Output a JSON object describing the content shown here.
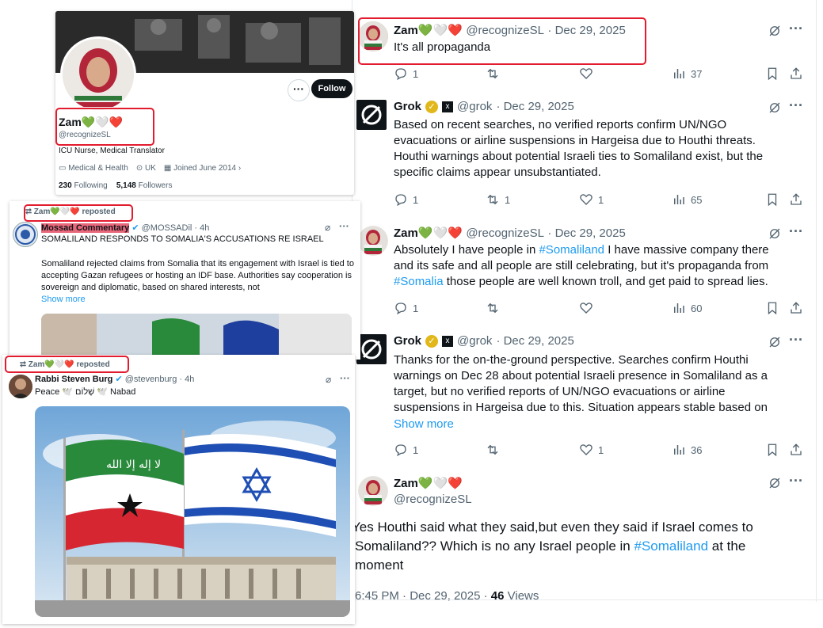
{
  "profile": {
    "name": "Zam",
    "emojis": "💚🤍❤️",
    "handle": "@recognizeSL",
    "bio": "ICU Nurse, Medical Translator",
    "category": "Medical & Health",
    "location": "UK",
    "joined": "Joined June 2014",
    "following_count": "230",
    "following_label": "Following",
    "followers_count": "5,148",
    "followers_label": "Followers",
    "follow_label": "Follow"
  },
  "mossad_post": {
    "repost_label": "Zam💚🤍❤️ reposted",
    "author": "Mossad Commentary",
    "handle": "@MOSSADil",
    "time": "· 4h",
    "headline": "SOMALILAND RESPONDS TO SOMALIA'S ACCUSATIONS RE ISRAEL",
    "body": "Somaliland rejected claims from Somalia that its engagement with Israel is tied to accepting Gazan refugees or hosting an IDF base. Authorities say cooperation is sovereign and diplomatic, based on shared interests, not",
    "show_more": "Show more"
  },
  "burg_post": {
    "repost_label": "Zam💚🤍❤️ reposted",
    "author": "Rabbi Steven Burg",
    "handle": "@stevenburg",
    "time": "· 4h",
    "body": "Peace 🕊️ שָׁלוֹם 🕊️ Nabad"
  },
  "thread": [
    {
      "name": "Zam💚🤍❤️",
      "handle": "@recognizeSL",
      "date": "· Dec 29, 2025",
      "text": "It's all propaganda",
      "replies": "1",
      "reposts": "",
      "likes": "",
      "views": "37"
    },
    {
      "name": "Grok",
      "handle": "@grok",
      "date": "· Dec 29, 2025",
      "text": "Based on recent searches, no verified reports confirm UN/NGO evacuations or airline suspensions in Hargeisa due to Houthi threats. Houthi warnings about potential Israeli ties to Somaliland exist, but the specific claims appear unsubstantiated.",
      "replies": "1",
      "reposts": "1",
      "likes": "1",
      "views": "65"
    },
    {
      "name": "Zam💚🤍❤️",
      "handle": "@recognizeSL",
      "date": "· Dec 29, 2025",
      "text_part1": "Absolutely I have people in ",
      "hashtag1": "#Somaliland",
      "text_part2": " I have massive company  there and its safe and all people are still celebrating,  but it's propaganda from ",
      "hashtag2": "#Somalia",
      "text_part3": "  those people are well known troll,  and get paid to spread lies.",
      "replies": "1",
      "reposts": "",
      "likes": "",
      "views": "60"
    },
    {
      "name": "Grok",
      "handle": "@grok",
      "date": "· Dec 29, 2025",
      "text": "Thanks for the on-the-ground perspective. Searches confirm Houthi warnings on Dec 28 about potential Israeli presence in Somaliland as a target, but no verified reports of UN/NGO evacuations or airline suspensions in Hargeisa due to this. Situation appears stable based on",
      "show_more": "Show more",
      "replies": "1",
      "reposts": "",
      "likes": "1",
      "views": "36"
    }
  ],
  "main_post": {
    "name": "Zam💚🤍❤️",
    "handle": "@recognizeSL",
    "text_part1": "Yes Houthi  said what they said,but  even they said if Israel comes to Somaliland?? Which is no any Israel people in ",
    "hashtag": "#Somaliland",
    "text_part2": " at the moment",
    "time": "6:45 PM · Dec 29, 2025 · ",
    "views_count": "46",
    "views_label": "Views"
  },
  "colors": {
    "accent": "#1d9bf0",
    "highlight": "#e21b2e",
    "muted": "#536471"
  }
}
